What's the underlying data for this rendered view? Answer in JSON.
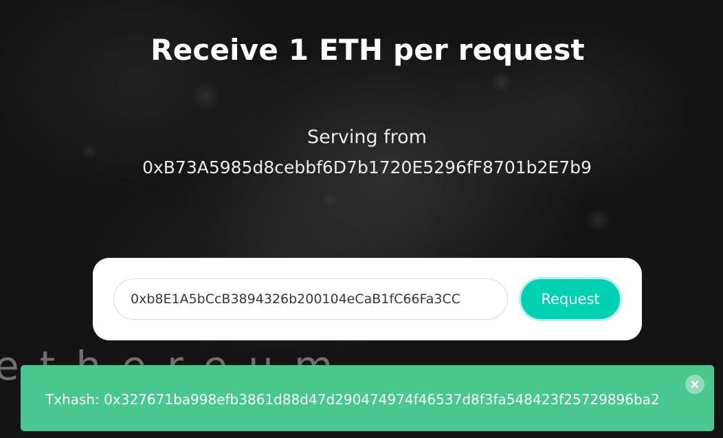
{
  "header": {
    "title": "Receive 1 ETH per request"
  },
  "faucet": {
    "serving_label": "Serving from",
    "serving_address": "0xB73A5985d8cebbf6D7b1720E5296fF8701b2E7b9"
  },
  "request_form": {
    "address_value": "0xb8E1A5bCcB3894326b200104eCaB1fC66Fa3CC",
    "button_label": "Request"
  },
  "background": {
    "watermark_text": "ethereum"
  },
  "notification": {
    "text": "Txhash: 0x327671ba998efb3861d88d47d290474974f46537d8f3fa548423f25729896ba2",
    "color": "#48c78e",
    "close_icon": "close-icon"
  },
  "colors": {
    "accent": "#00d1b2",
    "success": "#48c78e"
  }
}
